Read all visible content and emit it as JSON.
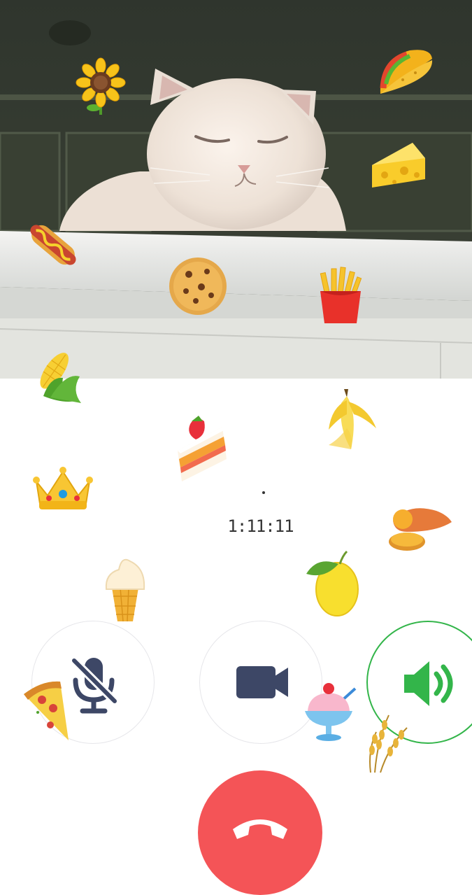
{
  "call": {
    "status_text": "",
    "timer": "1:11:11"
  },
  "controls": {
    "mute": {
      "icon": "microphone-muted-icon",
      "state": "muted"
    },
    "video": {
      "icon": "video-camera-icon"
    },
    "speaker": {
      "icon": "speaker-icon",
      "state": "on"
    },
    "end_call": {
      "icon": "phone-hangup-icon"
    }
  },
  "stickers": [
    "sunflower",
    "taco",
    "cheese",
    "hot-dog",
    "cookie",
    "french-fries",
    "corn",
    "banana",
    "strawberry-cake",
    "crown",
    "sweet-potato",
    "lemon",
    "ice-cream-cone",
    "pizza-slice",
    "shaved-ice",
    "rice-ear"
  ],
  "colors": {
    "speaker_active": "#33b54a",
    "end_call": "#f45457",
    "icon_dark": "#3d4766",
    "button_border": "#e6e6ea"
  }
}
